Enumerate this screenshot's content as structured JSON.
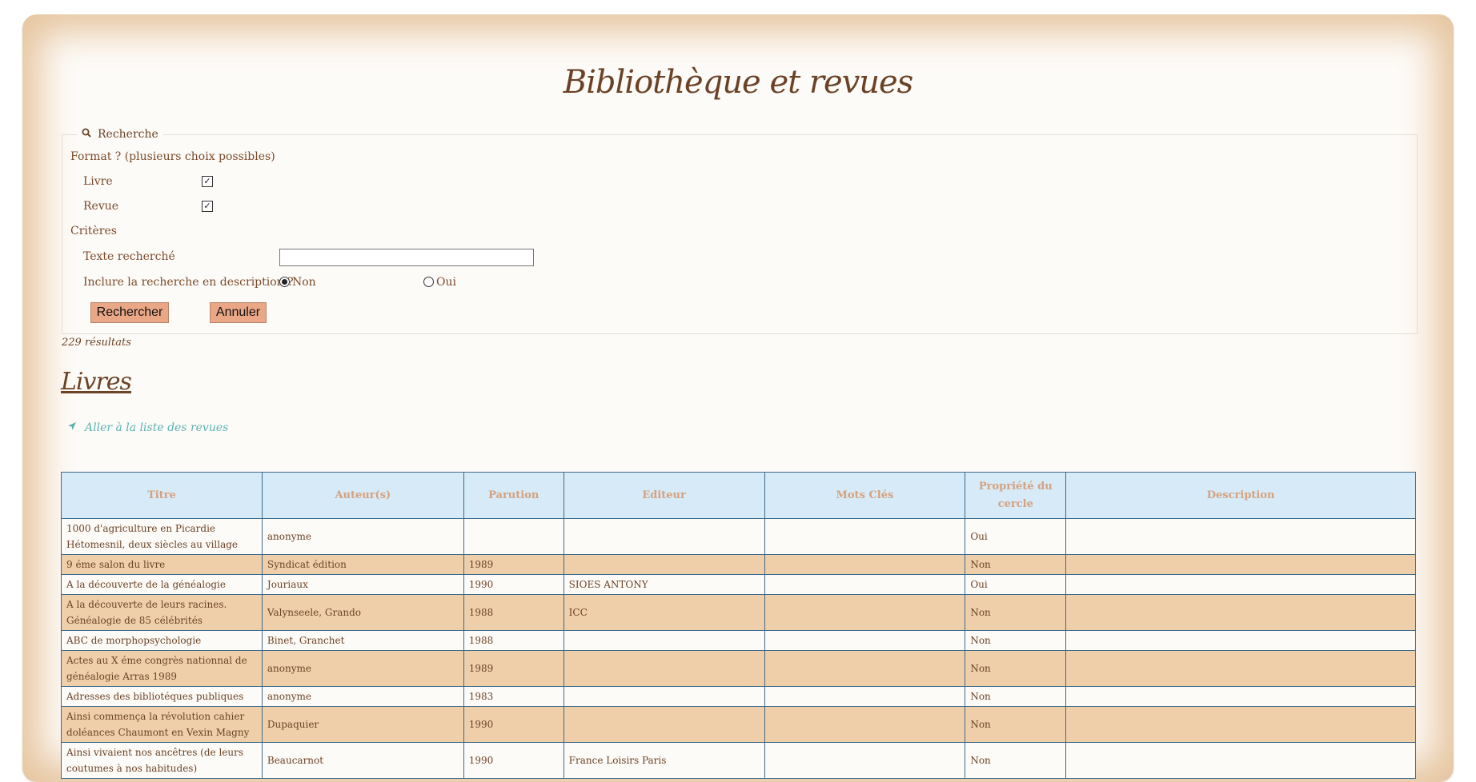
{
  "page": {
    "title": "Bibliothèque et revues"
  },
  "search": {
    "legend": "Recherche",
    "format_label": "Format ? (plusieurs choix possibles)",
    "formats": [
      {
        "label": "Livre",
        "checked": true
      },
      {
        "label": "Revue",
        "checked": true
      }
    ],
    "criteria_label": "Critères",
    "text_label": "Texte recherché",
    "text_value": "",
    "description_label": "Inclure la recherche en description ?",
    "description_options": [
      {
        "label": "Non",
        "selected": true
      },
      {
        "label": "Oui",
        "selected": false
      }
    ],
    "search_button": "Rechercher",
    "cancel_button": "Annuler"
  },
  "results_count": "229 résultats",
  "section": {
    "heading": "Livres",
    "goto_link": "Aller à la liste des revues"
  },
  "colors": {
    "accent": "#eaa786",
    "header_bg": "#d6eaf7",
    "row_alt": "#efcfaa",
    "link": "#5bb3b0"
  },
  "table": {
    "headers": [
      "Titre",
      "Auteur(s)",
      "Parution",
      "Editeur",
      "Mots Clés",
      "Propriété du cercle",
      "Description"
    ],
    "rows": [
      [
        "1000 d'agriculture en Picardie Hétomesnil, deux siècles au village",
        "anonyme",
        "",
        "",
        "",
        "Oui",
        ""
      ],
      [
        "9 éme salon du livre",
        "Syndicat édition",
        "1989",
        "",
        "",
        "Non",
        ""
      ],
      [
        "A la découverte de la généalogie",
        "Jouriaux",
        "1990",
        "SIOES ANTONY",
        "",
        "Oui",
        ""
      ],
      [
        "A la découverte de leurs racines. Généalogie de 85 célébrités",
        "Valynseele, Grando",
        "1988",
        "ICC",
        "",
        "Non",
        ""
      ],
      [
        "ABC de morphopsychologie",
        "Binet, Granchet",
        "1988",
        "",
        "",
        "Non",
        ""
      ],
      [
        "Actes au X éme congrès nationnal de généalogie Arras 1989",
        "anonyme",
        "1989",
        "",
        "",
        "Non",
        ""
      ],
      [
        "Adresses des bibliotéques publiques",
        "anonyme",
        "1983",
        "",
        "",
        "Non",
        ""
      ],
      [
        "Ainsi commença la révolution cahier doléances Chaumont en Vexin Magny",
        "Dupaquier",
        "1990",
        "",
        "",
        "Non",
        ""
      ],
      [
        "Ainsi vivaient nos ancêtres (de leurs coutumes à nos habitudes)",
        "Beaucarnot",
        "1990",
        "France Loisirs Paris",
        "",
        "Non",
        ""
      ]
    ]
  }
}
